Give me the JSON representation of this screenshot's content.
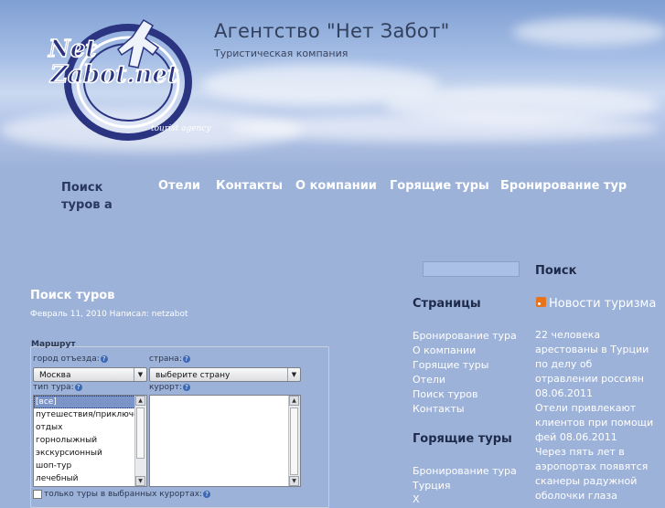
{
  "header": {
    "title": "Агентство \"Нет Забот\"",
    "subtitle": "Туристическая компания",
    "logo_text": "Net Zabot.net",
    "logo_tagline": "tourist agency"
  },
  "nav": {
    "items": [
      "Поиск туров а",
      "Отели",
      "Контакты",
      "О компании",
      "Горящие туры",
      "Бронирование тур"
    ]
  },
  "post": {
    "title": "Поиск туров",
    "meta": "Февраль 11, 2010 Написал: netzabot"
  },
  "form": {
    "legend": "Маршрут",
    "city_label": "город отъезда:",
    "city_value": "Москва",
    "country_label": "страна:",
    "country_value": "выберите страну",
    "tour_type_label": "тип тура:",
    "resort_label": "курорт:",
    "tour_types": [
      "[все]",
      "путешествия/приключени",
      "отдых",
      "горнолыжный",
      "экскурсионный",
      "шоп-тур",
      "лечебный"
    ],
    "only_selected_label": "только туры в выбранных курортах:"
  },
  "sidebar": {
    "search_label": "Поиск",
    "pages_heading": "Страницы",
    "pages": [
      "Бронирование тура",
      "О компании",
      "Горящие туры",
      "Отели",
      "Поиск туров",
      "Контакты"
    ],
    "hot_heading": "Горящие туры",
    "hot_links": [
      "Бронирование тура",
      "Турция",
      "Х"
    ]
  },
  "news": {
    "title": "Новости туризма",
    "items": [
      "22 человека арестованы в Турции по делу об отравлении россиян 08.06.2011",
      "Отели привлекают клиентов при помощи фей 08.06.2011",
      "Через пять лет в аэропортах появятся сканеры радужной оболочки глаза"
    ]
  },
  "colors": {
    "background": "#9db2d9",
    "accent": "#1e2a4a"
  }
}
